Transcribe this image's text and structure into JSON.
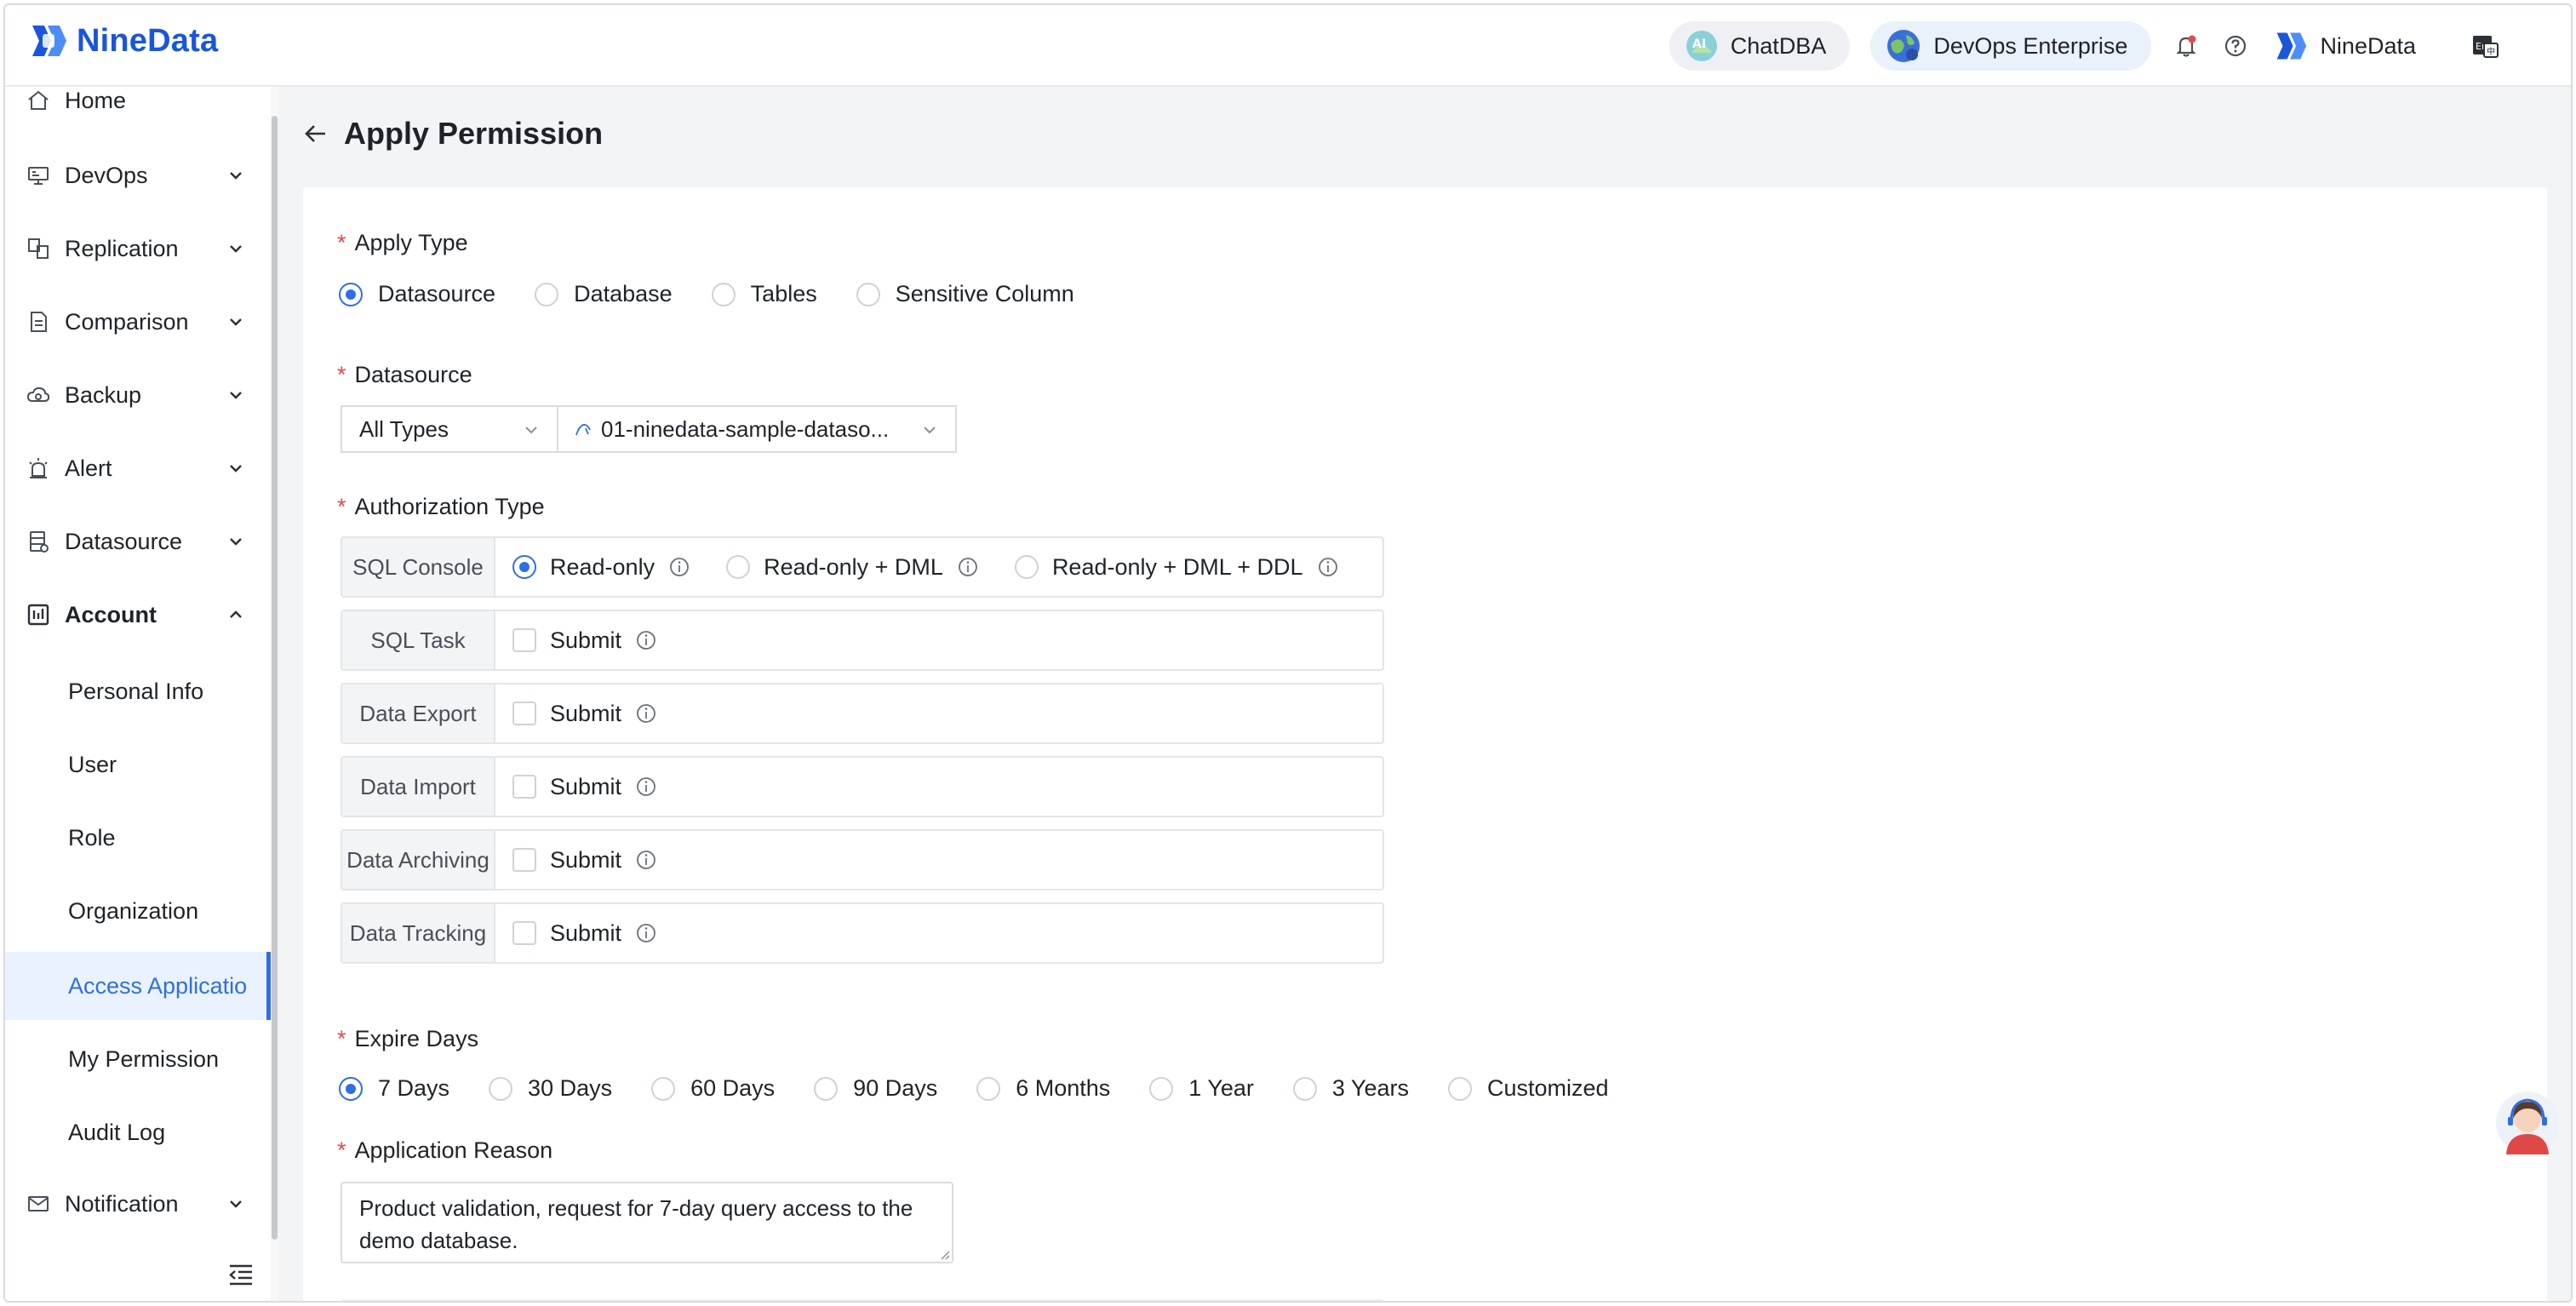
{
  "app": {
    "logo_text": "NineData",
    "colors": {
      "accent": "#2f6fe0",
      "brand": "#1a56db",
      "required": "#e5484d"
    }
  },
  "header": {
    "chatdba_label": "ChatDBA",
    "devops_label": "DevOps Enterprise",
    "user_name": "NineData",
    "icons": [
      "bell-icon",
      "help-icon",
      "language-icon"
    ]
  },
  "sidebar": {
    "items": [
      {
        "label": "Home",
        "icon": "home-icon"
      },
      {
        "label": "DevOps",
        "icon": "monitor-icon"
      },
      {
        "label": "Replication",
        "icon": "replication-icon"
      },
      {
        "label": "Comparison",
        "icon": "comparison-icon"
      },
      {
        "label": "Backup",
        "icon": "cloud-icon"
      },
      {
        "label": "Alert",
        "icon": "alarm-icon"
      },
      {
        "label": "Datasource",
        "icon": "database-icon"
      },
      {
        "label": "Account",
        "icon": "account-icon"
      },
      {
        "label": "Notification",
        "icon": "mail-icon"
      }
    ],
    "account_subitems": [
      {
        "label": "Personal Info"
      },
      {
        "label": "User"
      },
      {
        "label": "Role"
      },
      {
        "label": "Organization"
      },
      {
        "label": "Access Applicatio",
        "active": true
      },
      {
        "label": "My Permission"
      },
      {
        "label": "Audit Log"
      }
    ]
  },
  "page": {
    "title": "Apply Permission"
  },
  "form": {
    "apply_type": {
      "label": "Apply Type",
      "options": [
        "Datasource",
        "Database",
        "Tables",
        "Sensitive Column"
      ],
      "selected": "Datasource"
    },
    "datasource": {
      "label": "Datasource",
      "type_value": "All Types",
      "source_value": "01-ninedata-sample-dataso..."
    },
    "authorization": {
      "label": "Authorization Type",
      "sql_console": {
        "label": "SQL Console",
        "options": [
          "Read-only",
          "Read-only + DML",
          "Read-only + DML + DDL"
        ],
        "selected": "Read-only"
      },
      "rows": [
        {
          "label": "SQL Task",
          "option": "Submit"
        },
        {
          "label": "Data Export",
          "option": "Submit"
        },
        {
          "label": "Data Import",
          "option": "Submit"
        },
        {
          "label": "Data Archiving",
          "option": "Submit"
        },
        {
          "label": "Data Tracking",
          "option": "Submit"
        }
      ]
    },
    "expire_days": {
      "label": "Expire Days",
      "options": [
        "7 Days",
        "30 Days",
        "60 Days",
        "90 Days",
        "6 Months",
        "1 Year",
        "3 Years",
        "Customized"
      ],
      "selected": "7 Days"
    },
    "reason": {
      "label": "Application Reason",
      "value": "Product validation, request for 7-day query access to the demo database."
    }
  }
}
